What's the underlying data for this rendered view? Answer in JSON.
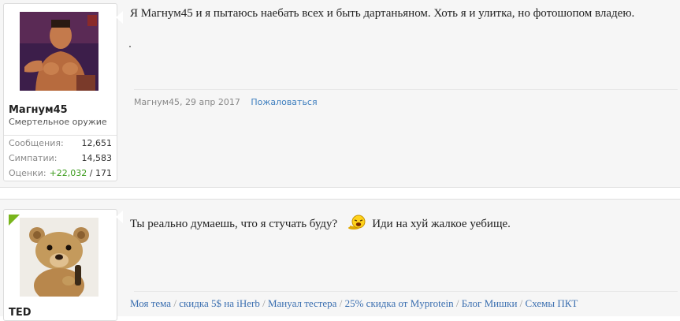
{
  "posts": [
    {
      "username": "Магнум45",
      "user_title": "Смертельное оружие",
      "stats": [
        {
          "label": "Сообщения:",
          "value": "12,651"
        },
        {
          "label": "Симпатии:",
          "value": "14,583"
        },
        {
          "label": "Оценки:",
          "positive": "+22,032",
          "sep": " / ",
          "negative": "171"
        }
      ],
      "text": "Я Магнум45 и я пытаюсь наебать всех и быть дартаньяном. Хоть я и улитка, но фотошопом владею.",
      "meta_author_date": "Магнум45, 29 апр 2017",
      "report_link": "Пожаловаться"
    },
    {
      "username": "TED",
      "text_before_smiley": "Ты реально думаешь, что я стучать буду?",
      "text_after_smiley": "Иди на хуй жалкое уебище.",
      "smiley_icon": "laughing-smiley-icon",
      "signature_links": [
        "Моя тема",
        "скидка 5$ на iHerb",
        "Мануал тестера",
        "25% скидка от Myprotein",
        "Блог Мишки",
        "Схемы ПКТ"
      ],
      "signature_separator": " / "
    }
  ],
  "colors": {
    "link": "#3b6fb0",
    "positive": "#3a9a1a",
    "corner_badge": "#79b51c",
    "background": "#f6f6f6"
  }
}
